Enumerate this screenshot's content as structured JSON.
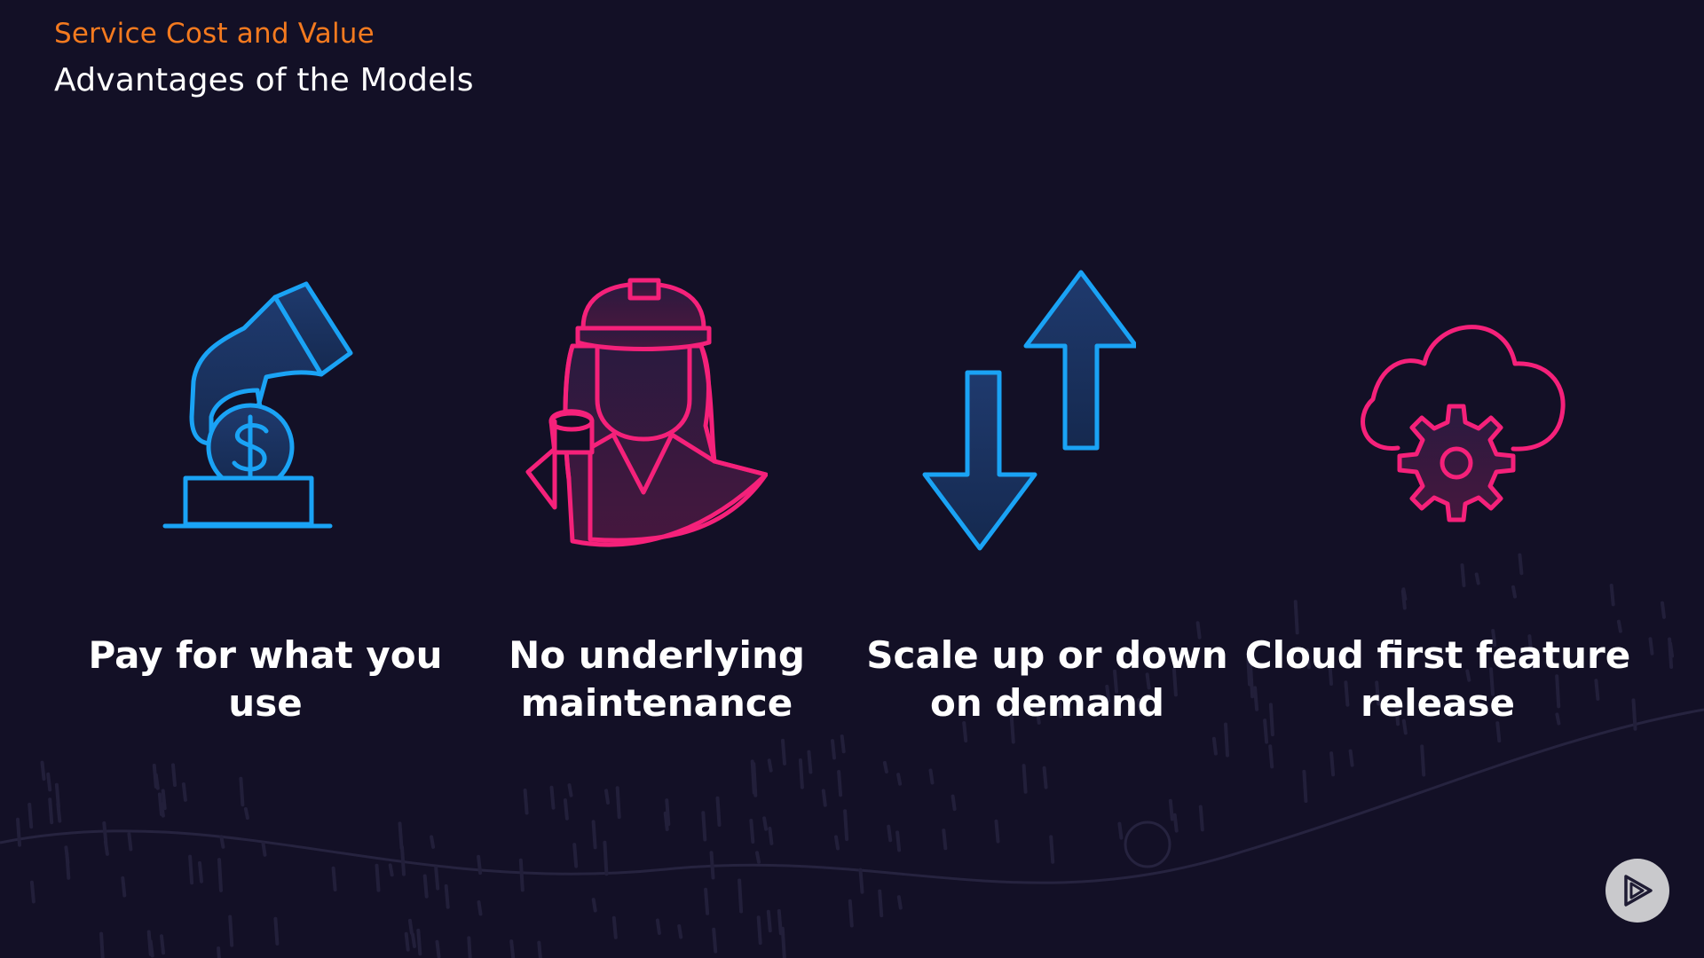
{
  "header": {
    "kicker": "Service Cost and Value",
    "title": "Advantages of the Models"
  },
  "advantages": [
    {
      "label_line1": "Pay for what you",
      "label_line2": "use",
      "icon": "hand-coin-icon",
      "color": "#1aa3f5"
    },
    {
      "label_line1": "No underlying",
      "label_line2": "maintenance",
      "icon": "engineer-icon",
      "color": "#f5217a"
    },
    {
      "label_line1": "Scale up or down",
      "label_line2": "on demand",
      "icon": "scale-arrows-icon",
      "color": "#1aa3f5"
    },
    {
      "label_line1": "Cloud first feature",
      "label_line2": "release",
      "icon": "cloud-gear-icon",
      "color": "#f5217a"
    }
  ],
  "colors": {
    "background": "#131026",
    "kicker": "#f47a1f",
    "blue": "#1aa3f5",
    "pink": "#f5217a",
    "player_button": "#c9c9cc"
  }
}
